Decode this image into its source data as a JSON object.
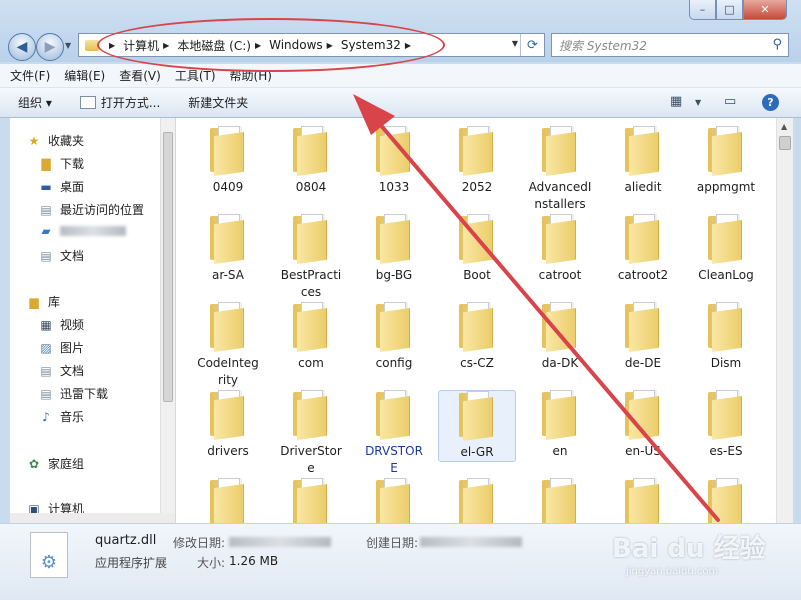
{
  "window": {
    "minimize": "–",
    "maximize": "□",
    "close": "✕"
  },
  "nav": {
    "back": "◀",
    "forward": "▶",
    "dropdown": "▼"
  },
  "breadcrumbs": [
    "计算机",
    "本地磁盘 (C:)",
    "Windows",
    "System32"
  ],
  "search": {
    "placeholder": "搜索 System32"
  },
  "menu": [
    "文件(F)",
    "编辑(E)",
    "查看(V)",
    "工具(T)",
    "帮助(H)"
  ],
  "toolbar": {
    "organize": "组织 ▾",
    "open_with": "打开方式...",
    "new_folder": "新建文件夹",
    "help": "?"
  },
  "sidebar": {
    "favorites": "收藏夹",
    "downloads": "下载",
    "desktop": "桌面",
    "recent": "最近访问的位置",
    "documents_fav": "文档",
    "libraries": "库",
    "videos": "视频",
    "pictures": "图片",
    "documents": "文档",
    "xunlei": "迅雷下载",
    "music": "音乐",
    "homegroup": "家庭组",
    "computer": "计算机"
  },
  "folders": [
    [
      "0409",
      "0804",
      "1033",
      "2052",
      "AdvancedI\nnstallers",
      "aliedit",
      "appmgmt"
    ],
    [
      "ar-SA",
      "BestPracti\nces",
      "bg-BG",
      "Boot",
      "catroot",
      "catroot2",
      "CleanLog"
    ],
    [
      "CodeInteg\nrity",
      "com",
      "config",
      "cs-CZ",
      "da-DK",
      "de-DE",
      "Dism"
    ],
    [
      "drivers",
      "DriverStor\ne",
      "DRVSTOR\nE",
      "el-GR",
      "en",
      "en-US",
      "es-ES"
    ],
    [
      "",
      "",
      "",
      "",
      "",
      "",
      ""
    ]
  ],
  "status": {
    "name": "quartz.dll",
    "type": "应用程序扩展",
    "modified_label": "修改日期:",
    "size_label": "大小:",
    "size_value": "1.26 MB",
    "created_label": "创建日期:"
  },
  "watermark": {
    "main": "Bai du 经验",
    "sub": "jingyan.baidu.com"
  },
  "colors": {
    "annotation": "#d8444a",
    "highlight_text": "#1a3aa0"
  }
}
